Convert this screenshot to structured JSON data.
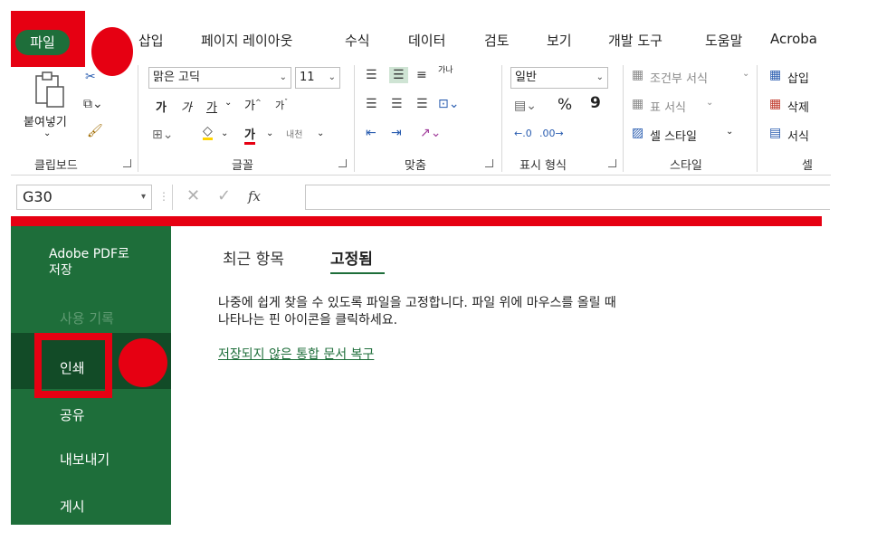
{
  "ribbon_tabs": {
    "file": "파일",
    "items": [
      "삽입",
      "페이지 레이아웃",
      "수식",
      "데이터",
      "검토",
      "보기",
      "개발 도구",
      "도움말",
      "Acroba"
    ]
  },
  "clipboard": {
    "paste_label": "붙여넣기",
    "group_label": "클립보드"
  },
  "font": {
    "name": "맑은 고딕",
    "size": "11",
    "bold": "가",
    "italic": "가",
    "underline": "가",
    "grow": "가",
    "shrink": "가",
    "font_color": "가",
    "phonetic": "내천",
    "group_label": "글꼴"
  },
  "alignment": {
    "wrap": "가나",
    "group_label": "맞춤"
  },
  "number": {
    "format": "일반",
    "percent": "%",
    "comma": "9",
    "group_label": "표시 형식"
  },
  "styles": {
    "conditional": "조건부 서식",
    "table": "표 서식",
    "cell": "셀 스타일",
    "group_label": "스타일"
  },
  "cells": {
    "insert": "삽입",
    "delete": "삭제",
    "format": "서식",
    "group_label": "셀"
  },
  "formula_bar": {
    "name_box": "G30",
    "fx": "fx"
  },
  "backstage": {
    "sidebar": {
      "save_pdf_line1": "Adobe PDF로",
      "save_pdf_line2": "저장",
      "history": "사용 기록",
      "print": "인쇄",
      "share": "공유",
      "export": "내보내기",
      "publish": "게시"
    },
    "tabs": {
      "recent": "최근 항목",
      "pinned": "고정됨"
    },
    "info_text": "나중에 쉽게 찾을 수 있도록 파일을 고정합니다. 파일 위에 마우스를 올릴 때 나타나는 핀 아이콘을 클릭하세요.",
    "recover_link": "저장되지 않은 통합 문서 복구"
  },
  "colors": {
    "excel_green": "#1e6e3a",
    "annotation_red": "#e60012"
  }
}
